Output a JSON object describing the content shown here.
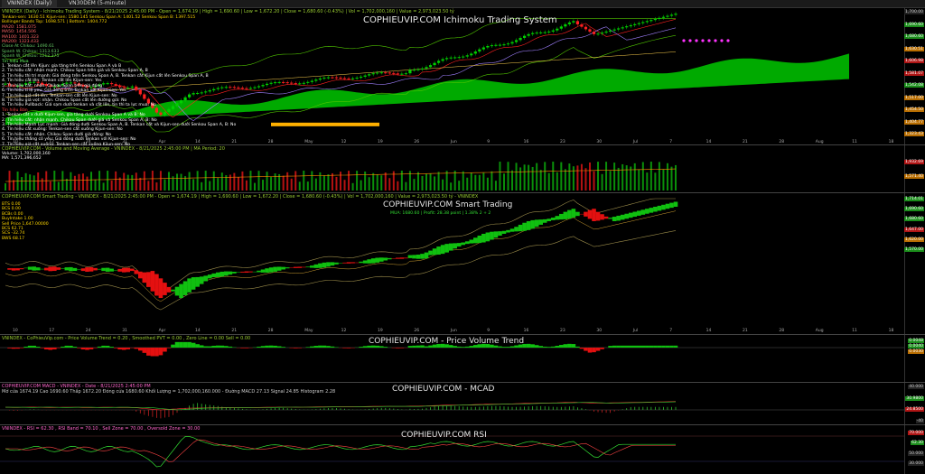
{
  "tabs": [
    {
      "label": "VNINDEX (Daily)",
      "active": true
    },
    {
      "label": "VN30DEM (5-minute)",
      "active": false
    }
  ],
  "panes": {
    "ichimoku": {
      "brand": "COPHIEUVIP.COM Ichimoku Trading System",
      "header": "VNINDEX (Daily) - Ichimoku Trading System - 8/21/2025 2:45:00 PM - Open = 1,674.19 | High = 1,690.60 | Low = 1,672.20 | Close = 1,680.60 (-0.43%) | Vol = 1,702,000,160 | Value = 2,973,023.50 tỷ",
      "legend": [
        {
          "text": "Tenkan-sen: 1630.51   Kijun-sen: 1580.145   Senkou Span A: 1401.52   Senkou Span B: 1397.515",
          "color": "#ffd700"
        },
        {
          "text": "Bollinger Bands Top: 1698.571 | Bottom: 1404.772",
          "color": "#ffd700"
        },
        {
          "text": "MA20: 1581.075",
          "color": "#ff6666"
        },
        {
          "text": "MA50: 1454.506",
          "color": "#ff6666"
        },
        {
          "text": "MA100: 1401.323",
          "color": "#ff6666"
        },
        {
          "text": "MA200: 1323.433",
          "color": "#ff6666"
        },
        {
          "text": "Close At Chikou: 1490.61",
          "color": "#66cc66"
        },
        {
          "text": "Spanh W. Chikou: 1313.633",
          "color": "#66cc66"
        },
        {
          "text": "Spanh W. Chikou: 1212.375",
          "color": "#66cc66"
        },
        {
          "text": "Tín hiệu Mua",
          "color": "#66ff66"
        },
        {
          "text": "1. Tenkan cắt lên Kijun: gia tăng trên Senkou Span A và B",
          "color": "#ffffff"
        },
        {
          "text": "2. Tín hiệu cắt: nhận mạnh. Chikou Span trên giá và Senkou Span A, B",
          "color": "#ffffff"
        },
        {
          "text": "3. Tín hiệu thì trí mạnh: Giá đóng trên Senkou Span A, B. Tenkan cắt Kijun cắt lên Senkou Span A, B",
          "color": "#ffffff"
        },
        {
          "text": "4. Tín hiệu cắt lên: Tenkan cắt lên Kijun-sen: Yes",
          "color": "#ffffff"
        },
        {
          "text": "5. Tín hiệu cắt: nhận. Chikou Span trên giá đóng",
          "color": "#ffffff"
        },
        {
          "text": "6. Tín hiệu tỉ lệ yeu: Giá dóng trên Tenkan với Kijun-sen: Yes",
          "color": "#ffffff"
        },
        {
          "text": "7. Tín hiệu giá cắt lên: Tenkan-sen cắt lên Kijun-sen: No",
          "color": "#ffffff"
        },
        {
          "text": "8. Tín hiệu giá vọt: nhận. Chikou Span cắt lên đường giá: No",
          "color": "#ffffff"
        },
        {
          "text": "9. Tín hiệu Pullback: Giá sạm dưới tenkan và cắt lên, tin thì ta lực mua: No",
          "color": "#ffffff"
        },
        {
          "text": "Tín hiệu Bán",
          "color": "#ff4444"
        },
        {
          "text": "1. Tenkan cắt x dưới Kijun-sen, gia tăng dưới Senkou Span A và B: No",
          "color": "#ffffff"
        },
        {
          "text": "2. Tín hiệu cắt: nhận mạnh. Chikou Span dưới giá và Senkou Span A, B: No",
          "color": "#ffffff"
        },
        {
          "text": "3. Tín hiệu Mạnh Lực mạnh: Giá đóng dưới Senkou Span A, B. Tenkan cắt và Kijun-sen dưới Senkou Span A, B: No",
          "color": "#ffffff"
        },
        {
          "text": "4. Tín hiệu cắt xuống: Tenkan-sen cắt xuống Kijun-sen: No",
          "color": "#ffffff"
        },
        {
          "text": "5. Tín hiệu cắt: nhận. Chikou Span dưới giá đóng: No",
          "color": "#ffffff"
        },
        {
          "text": "6. Tín hiệu thắng có yếu: Giá dóng dưới Tenkan với Kijun-sen: No",
          "color": "#ffffff"
        },
        {
          "text": "7. Tín hiệu giá cắt xuống: Tenkan-sen cắt xuống Kijun-sen: No",
          "color": "#ffffff"
        },
        {
          "text": "8. Tín hiệu giá vọt: nhận. Chikou Span giá cắt xuống đường giá: No",
          "color": "#ffffff"
        },
        {
          "text": "9. Tín hiệu Pullback Nguợc: Giá sạm trên tenkan và cắt xuống, có thể lực bán bán: No",
          "color": "#ffffff"
        }
      ],
      "y_ticks": [
        {
          "label": "1,700.00",
          "style": ""
        },
        {
          "label": "1,690.60",
          "style": "g"
        },
        {
          "label": "1,680.60",
          "style": "g"
        },
        {
          "label": "1,630.51",
          "style": "o"
        },
        {
          "label": "1,606.98",
          "style": "r"
        },
        {
          "label": "1,581.07",
          "style": "r"
        },
        {
          "label": "1,542.08",
          "style": "g"
        },
        {
          "label": "1,517.00",
          "style": "o"
        },
        {
          "label": "1,454.50",
          "style": "o"
        },
        {
          "label": "1,404.77",
          "style": "o"
        },
        {
          "label": "1,323.43",
          "style": "o"
        }
      ]
    },
    "volume": {
      "header": "COPHIEUVIP.COM - Volume and Moving Average - VNINDEX - 8/21/2025 2:45:00 PM | MA Period: 20",
      "legend": [
        {
          "text": "Volume: 1,702,000,160",
          "color": "#ffffff"
        },
        {
          "text": "MA: 1,571,396,652",
          "color": "#ffffff"
        }
      ],
      "y_ticks": [
        {
          "label": "1,932.69",
          "style": "r"
        },
        {
          "label": "1,571.40",
          "style": "o"
        }
      ]
    },
    "smart": {
      "brand": "COPHIEUVIP.COM Smart Trading",
      "subline": "MUA: 1680.60 | Profit: 28.38 point | 1.38%   2 + 2",
      "header": "COPHIEUVIP.COM Smart Trading - VNINDEX - 8/21/2025 2:45:00 PM - Open = 1,674.19 | High = 1,690.60 | Low = 1,672.20 | Close = 1,680.60 (-0.43%) | Vol = 1,702,000,160 | Value = 2,973,023.50 tỷ - VNINDEX",
      "legend": [
        {
          "text": "BTS        0.00",
          "color": "#ffd700"
        },
        {
          "text": "BCS        0.00",
          "color": "#ffd700"
        },
        {
          "text": "BCBs      0.00",
          "color": "#ffd700"
        },
        {
          "text": "BuyIntake    1.00",
          "color": "#ffd700"
        },
        {
          "text": "Sell Price  1,647.00000",
          "color": "#ffd700"
        },
        {
          "text": "BCS     62.71",
          "color": "#ffd700"
        },
        {
          "text": "SCS     -32.74",
          "color": "#ffd700"
        },
        {
          "text": "BWS      68.17",
          "color": "#ffd700"
        }
      ],
      "y_ticks": [
        {
          "label": "1,714.01",
          "style": "g"
        },
        {
          "label": "1,690.60",
          "style": "g"
        },
        {
          "label": "1,680.60",
          "style": "g"
        },
        {
          "label": "1,647.00",
          "style": "r"
        },
        {
          "label": "1,620.00",
          "style": "o"
        },
        {
          "label": "1,570.00",
          "style": "g"
        }
      ]
    },
    "pvt": {
      "brand": "COPHIEUVIP.COM - Price Volume Trend",
      "header": "VNINDEX - CoPhieuVip.com - Price Volume Trend = 0.20 , Smoothed PVT = 0.00 , Zero Line = 0.00 Sell = 0.00",
      "y_ticks": [
        {
          "label": "0.0048",
          "style": "g"
        },
        {
          "label": "0.0040",
          "style": "g"
        },
        {
          "label": "0.0030",
          "style": "o"
        }
      ]
    },
    "macd": {
      "brand": "COPHIEUVIP.COM - MCAD",
      "header": "COPHIEUVIP.COM MACD - VNINDEX - Date - 8/21/2025 2:45:00 PM",
      "subheader": "Mở cửa 1674.19  Cao 1690.60  Thấp 1672.20  Đóng cửa 1680.60  Khối Lượng = 1,702,000,160.000 - Đuờng MACD 27.13  Signal 24.85  Histogram 2.28",
      "y_ticks": [
        {
          "label": "40.000",
          "style": ""
        },
        {
          "label": "30.9800",
          "style": "g"
        },
        {
          "label": "24.8500",
          "style": "r"
        },
        {
          "label": "-40",
          "style": ""
        }
      ]
    },
    "rsi": {
      "brand": "COPHIEUVIP.COM RSI",
      "header": "VNINDEX - RSI = 62.30 , RSI Band = 70.10 , Sell Zone = 70.00 , Oversold Zone = 30.00",
      "y_ticks": [
        {
          "label": "70.000",
          "style": "r"
        },
        {
          "label": "62.30",
          "style": "g"
        },
        {
          "label": "50.000",
          "style": ""
        },
        {
          "label": "30.000",
          "style": ""
        }
      ]
    }
  },
  "x_axis": {
    "labels": [
      "10",
      "17",
      "24",
      "31",
      "Apr",
      "14",
      "21",
      "28",
      "May",
      "12",
      "19",
      "26",
      "Jun",
      "9",
      "16",
      "23",
      "30",
      "Jul",
      "7",
      "14",
      "21",
      "28",
      "Aug",
      "11",
      "18"
    ]
  },
  "colors": {
    "cloud_bull": "#00c800",
    "cloud_bear": "#ffb000",
    "candle_up": "#00d000",
    "candle_down": "#ff2020",
    "bb": "#4fc400",
    "tenkan": "#ff2020",
    "kijun": "#a080ff",
    "smart_band": "#9b8c4a",
    "smart_pos": "#10c010",
    "smart_neg": "#e41010"
  }
}
